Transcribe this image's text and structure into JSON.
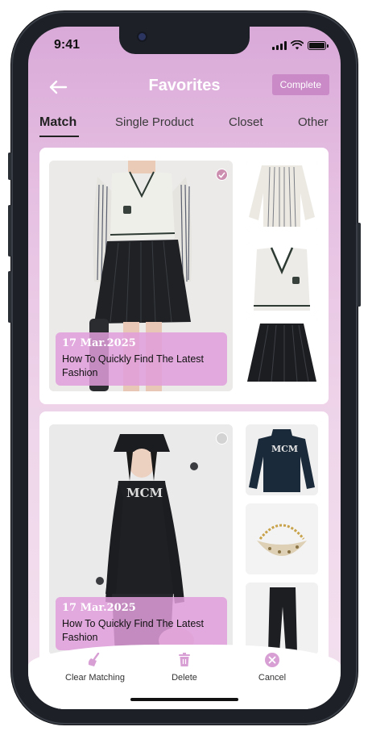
{
  "status_bar": {
    "time": "9:41"
  },
  "header": {
    "title": "Favorites",
    "complete_label": "Complete"
  },
  "tabs": [
    {
      "label": "Match",
      "active": true
    },
    {
      "label": "Single Product",
      "active": false
    },
    {
      "label": "Closet",
      "active": false
    },
    {
      "label": "Other",
      "active": false
    }
  ],
  "cards": [
    {
      "selected": true,
      "date": "17 Mar.2025",
      "headline": "How To Quickly Find The Latest Fashion",
      "main_image": "model-striped-shirt-vest-black-skirt",
      "items": [
        "striped-shirt",
        "knit-vest",
        "pleated-skirt"
      ]
    },
    {
      "selected": false,
      "date": "17 Mar.2025",
      "headline": "How To Quickly Find The Latest Fashion",
      "main_image": "model-black-mcm-top-bucket-hat",
      "items": [
        "black-mcm-top",
        "chain-shoulder-bag",
        "black-trousers"
      ]
    }
  ],
  "bottom_actions": [
    {
      "label": "Clear Matching",
      "icon": "broom-icon"
    },
    {
      "label": "Delete",
      "icon": "trash-icon"
    },
    {
      "label": "Cancel",
      "icon": "close-circle-icon"
    }
  ],
  "colors": {
    "accent": "#d9a9d8",
    "button": "#c98ac7",
    "caption_bg": "#df9edb",
    "icon_tint": "#d79fd4"
  }
}
